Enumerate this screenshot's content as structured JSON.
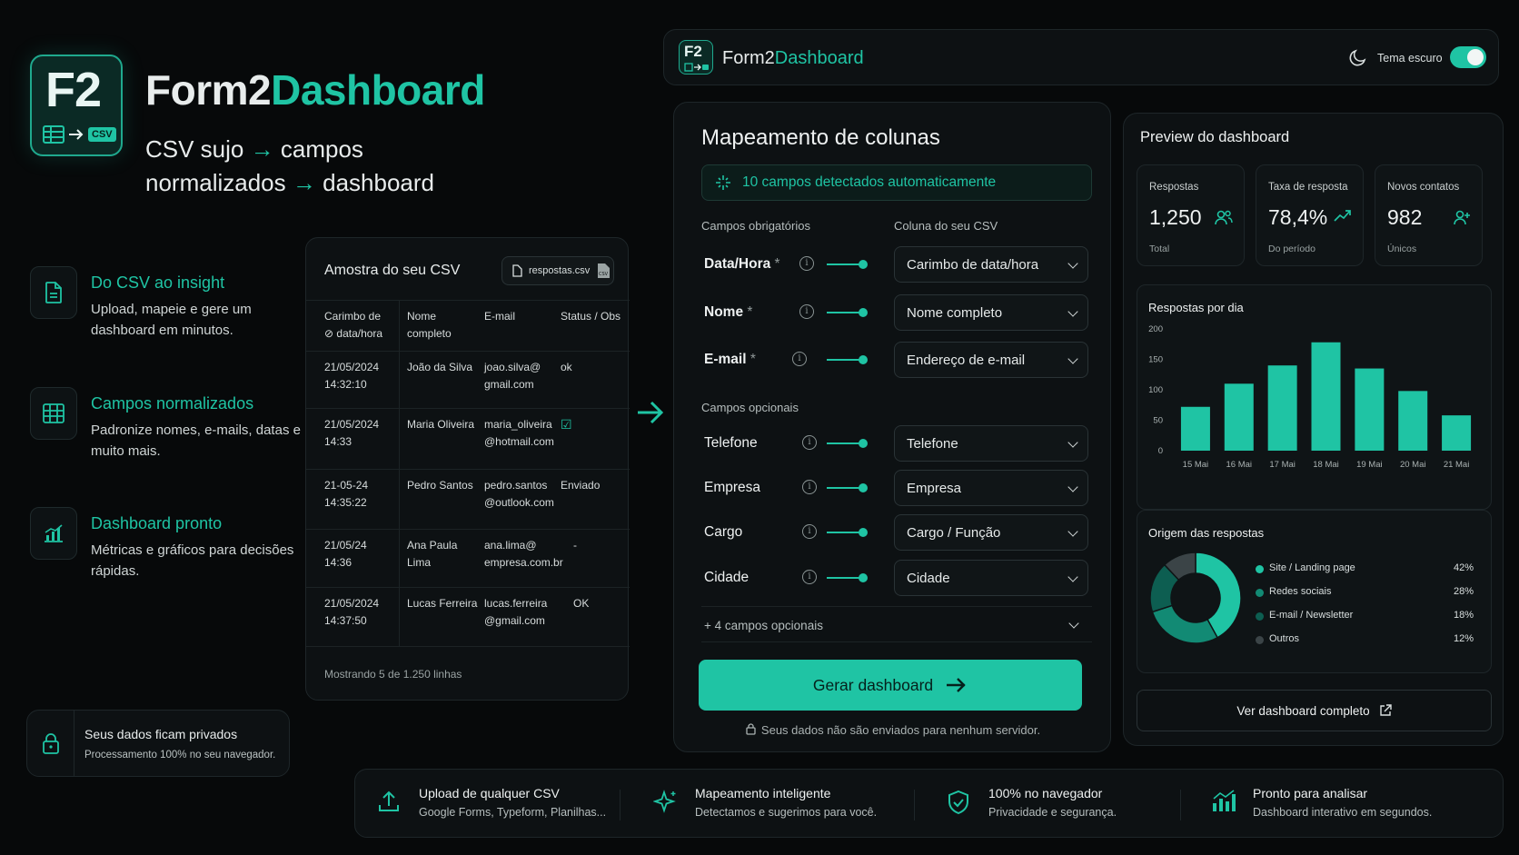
{
  "brand": {
    "logo_text": "F2",
    "logo_tag": "CSV",
    "name_a": "Form2",
    "name_b": "Dashboard",
    "tagline_1a": "CSV sujo",
    "tagline_1b": "campos",
    "tagline_2a": "normalizados",
    "tagline_2b": "dashboard"
  },
  "features": [
    {
      "title": "Do CSV ao insight",
      "desc": "Upload, mapeie e gere um dashboard em minutos.",
      "icon": "file-icon"
    },
    {
      "title": "Campos normalizados",
      "desc": "Padronize nomes, e-mails, datas e muito mais.",
      "icon": "table-icon"
    },
    {
      "title": "Dashboard pronto",
      "desc": "Métricas e gráficos para decisões rápidas.",
      "icon": "chart-icon"
    }
  ],
  "privacy": {
    "title": "Seus dados ficam privados",
    "desc": "Processamento 100% no seu navegador."
  },
  "sample": {
    "title": "Amostra do seu CSV",
    "file": "respostas.csv",
    "headers": [
      "Carimbo de ⊘ data/hora",
      "Nome completo",
      "E-mail",
      "Status / Obs"
    ],
    "rows": [
      [
        "21/05/2024 14:32:10",
        "João da Silva",
        "joao.silva@ gmail.com",
        "ok"
      ],
      [
        "21/05/2024 14:33",
        "Maria Oliveira",
        "maria_oliveira @hotmail.com",
        "☑"
      ],
      [
        "21-05-24 14:35:22",
        "Pedro Santos",
        "pedro.santos @outlook.com",
        "Enviado"
      ],
      [
        "21/05/24 14:36",
        "Ana Paula Lima",
        "ana.lima@ empresa.com.br",
        "-"
      ],
      [
        "21/05/2024 14:37:50",
        "Lucas Ferreira",
        "lucas.ferreira @gmail.com",
        "OK"
      ]
    ],
    "footer": "Mostrando 5 de 1.250 linhas"
  },
  "header": {
    "logo_text": "F2",
    "name_a": "Form2",
    "name_b": "Dashboard",
    "theme_label": "Tema escuro",
    "theme_on": true
  },
  "mapping": {
    "title": "Mapeamento de colunas",
    "detected": "10 campos detectados automaticamente",
    "required_label": "Campos obrigatórios",
    "csv_col_label": "Coluna do seu CSV",
    "optional_label": "Campos opcionais",
    "required": [
      {
        "field": "Data/Hora",
        "star": "*",
        "column": "Carimbo de data/hora"
      },
      {
        "field": "Nome",
        "star": "*",
        "column": "Nome completo"
      },
      {
        "field": "E-mail",
        "star": "*",
        "column": "Endereço de e-mail"
      }
    ],
    "optional": [
      {
        "field": "Telefone",
        "column": "Telefone"
      },
      {
        "field": "Empresa",
        "column": "Empresa"
      },
      {
        "field": "Cargo",
        "column": "Cargo / Função"
      },
      {
        "field": "Cidade",
        "column": "Cidade"
      }
    ],
    "more": "+ 4 campos opcionais",
    "button": "Gerar dashboard",
    "note": "Seus dados não são enviados para nenhum servidor."
  },
  "preview": {
    "title": "Preview do dashboard",
    "kpis": [
      {
        "label": "Respostas",
        "value": "1,250",
        "sub": "Total",
        "icon": "users-icon"
      },
      {
        "label": "Taxa de resposta",
        "value": "78,4%",
        "sub": "Do período",
        "icon": "trend-up-icon"
      },
      {
        "label": "Novos contatos",
        "value": "982",
        "sub": "Únicos",
        "icon": "user-plus-icon"
      }
    ],
    "pie_title": "Origem das respostas",
    "link": "Ver dashboard completo"
  },
  "chart_data": [
    {
      "type": "bar",
      "title": "Respostas por dia",
      "categories": [
        "15 Mai",
        "16 Mai",
        "17 Mai",
        "18 Mai",
        "19 Mai",
        "20 Mai",
        "21 Mai"
      ],
      "values": [
        72,
        110,
        140,
        178,
        135,
        98,
        58
      ],
      "ylim": [
        0,
        200
      ],
      "yticks": [
        0,
        50,
        100,
        150,
        200
      ],
      "color": "#1fc4a4"
    },
    {
      "type": "pie",
      "title": "Origem das respostas",
      "labels": [
        "Site / Landing page",
        "Redes sociais",
        "E-mail / Newsletter",
        "Outros"
      ],
      "values": [
        42,
        28,
        18,
        12
      ],
      "display": [
        "42%",
        "28%",
        "18%",
        "12%"
      ],
      "colors": [
        "#1fc4a4",
        "#128a74",
        "#0d5e51",
        "#3b4447"
      ]
    }
  ],
  "bottom": [
    {
      "title": "Upload de qualquer CSV",
      "desc": "Google Forms, Typeform, Planilhas...",
      "icon": "upload-icon"
    },
    {
      "title": "Mapeamento inteligente",
      "desc": "Detectamos e sugerimos para você.",
      "icon": "sparkle-icon"
    },
    {
      "title": "100% no navegador",
      "desc": "Privacidade e segurança.",
      "icon": "shield-icon"
    },
    {
      "title": "Pronto para analisar",
      "desc": "Dashboard interativo em segundos.",
      "icon": "bar-chart-icon"
    }
  ]
}
